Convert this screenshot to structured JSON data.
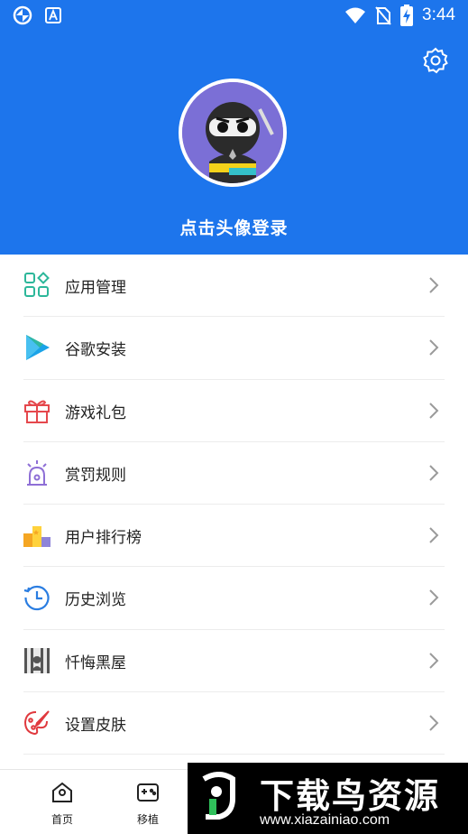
{
  "status_bar": {
    "time": "3:44"
  },
  "profile": {
    "login_prompt": "点击头像登录"
  },
  "menu": {
    "items": [
      {
        "label": "应用管理",
        "icon": "app-grid-icon",
        "color": "#2cb79a"
      },
      {
        "label": "谷歌安装",
        "icon": "google-play-icon",
        "color": "#28a0e8"
      },
      {
        "label": "游戏礼包",
        "icon": "gift-icon",
        "color": "#e5484d"
      },
      {
        "label": "赏罚规则",
        "icon": "alarm-light-icon",
        "color": "#8e6fd6"
      },
      {
        "label": "用户排行榜",
        "icon": "ranking-icon",
        "color": "#f5a623"
      },
      {
        "label": "历史浏览",
        "icon": "history-icon",
        "color": "#2a7de1"
      },
      {
        "label": "忏悔黑屋",
        "icon": "jail-icon",
        "color": "#555555"
      },
      {
        "label": "设置皮肤",
        "icon": "palette-icon",
        "color": "#e0393e"
      }
    ]
  },
  "bottom_nav": {
    "tabs": [
      {
        "label": "首页",
        "icon": "home-icon"
      },
      {
        "label": "移植",
        "icon": "gamepad-icon"
      }
    ]
  },
  "watermark": {
    "title": "下载鸟资源",
    "url": "www.xiazainiao.com"
  },
  "colors": {
    "header": "#1d75ec",
    "divider": "#ececec"
  }
}
